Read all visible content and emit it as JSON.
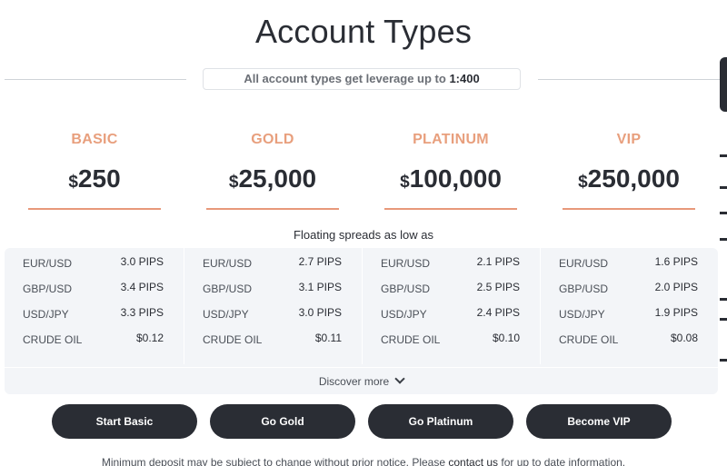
{
  "header": {
    "title": "Account Types",
    "leverage_prefix": "All account types get leverage up to ",
    "leverage_value": "1:400"
  },
  "accounts": [
    {
      "name": "BASIC",
      "currency": "$",
      "deposit": "250"
    },
    {
      "name": "GOLD",
      "currency": "$",
      "deposit": "25,000"
    },
    {
      "name": "PLATINUM",
      "currency": "$",
      "deposit": "100,000"
    },
    {
      "name": "VIP",
      "currency": "$",
      "deposit": "250,000"
    }
  ],
  "spreads": {
    "label": "Floating spreads as low as",
    "columns": [
      {
        "rows": [
          {
            "pair": "EUR/USD",
            "value": "3.0 PIPS"
          },
          {
            "pair": "GBP/USD",
            "value": "3.4 PIPS"
          },
          {
            "pair": "USD/JPY",
            "value": "3.3 PIPS"
          },
          {
            "pair": "CRUDE OIL",
            "value": "$0.12"
          }
        ]
      },
      {
        "rows": [
          {
            "pair": "EUR/USD",
            "value": "2.7 PIPS"
          },
          {
            "pair": "GBP/USD",
            "value": "3.1 PIPS"
          },
          {
            "pair": "USD/JPY",
            "value": "3.0 PIPS"
          },
          {
            "pair": "CRUDE OIL",
            "value": "$0.11"
          }
        ]
      },
      {
        "rows": [
          {
            "pair": "EUR/USD",
            "value": "2.1 PIPS"
          },
          {
            "pair": "GBP/USD",
            "value": "2.5 PIPS"
          },
          {
            "pair": "USD/JPY",
            "value": "2.4 PIPS"
          },
          {
            "pair": "CRUDE OIL",
            "value": "$0.10"
          }
        ]
      },
      {
        "rows": [
          {
            "pair": "EUR/USD",
            "value": "1.6 PIPS"
          },
          {
            "pair": "GBP/USD",
            "value": "2.0 PIPS"
          },
          {
            "pair": "USD/JPY",
            "value": "1.9 PIPS"
          },
          {
            "pair": "CRUDE OIL",
            "value": "$0.08"
          }
        ]
      }
    ],
    "discover_label": "Discover more",
    "discover_icon": "chevron-down-icon"
  },
  "buttons": [
    {
      "label": "Start Basic"
    },
    {
      "label": "Go Gold"
    },
    {
      "label": "Go Platinum"
    },
    {
      "label": "Become VIP"
    }
  ],
  "footnote": {
    "text_before": "Minimum deposit may be subject to change without prior notice. Please ",
    "link": "contact us",
    "text_after": " for up to date information."
  },
  "colors": {
    "accent": "#e89f7d",
    "dark": "#2a2d34",
    "panel": "#f3f5f8"
  }
}
